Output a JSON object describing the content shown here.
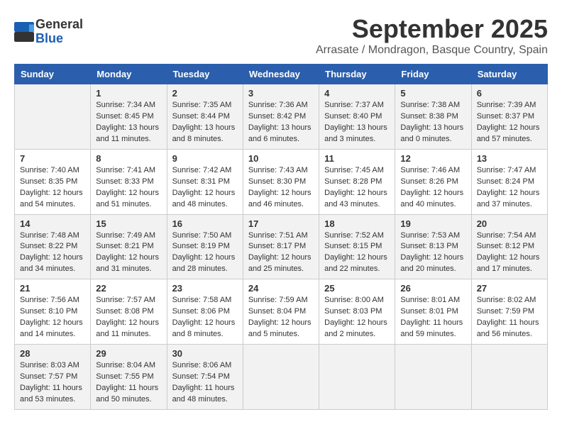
{
  "header": {
    "logo_line1": "General",
    "logo_line2": "Blue",
    "month": "September 2025",
    "location": "Arrasate / Mondragon, Basque Country, Spain"
  },
  "weekdays": [
    "Sunday",
    "Monday",
    "Tuesday",
    "Wednesday",
    "Thursday",
    "Friday",
    "Saturday"
  ],
  "weeks": [
    [
      {
        "day": "",
        "info": ""
      },
      {
        "day": "1",
        "info": "Sunrise: 7:34 AM\nSunset: 8:45 PM\nDaylight: 13 hours\nand 11 minutes."
      },
      {
        "day": "2",
        "info": "Sunrise: 7:35 AM\nSunset: 8:44 PM\nDaylight: 13 hours\nand 8 minutes."
      },
      {
        "day": "3",
        "info": "Sunrise: 7:36 AM\nSunset: 8:42 PM\nDaylight: 13 hours\nand 6 minutes."
      },
      {
        "day": "4",
        "info": "Sunrise: 7:37 AM\nSunset: 8:40 PM\nDaylight: 13 hours\nand 3 minutes."
      },
      {
        "day": "5",
        "info": "Sunrise: 7:38 AM\nSunset: 8:38 PM\nDaylight: 13 hours\nand 0 minutes."
      },
      {
        "day": "6",
        "info": "Sunrise: 7:39 AM\nSunset: 8:37 PM\nDaylight: 12 hours\nand 57 minutes."
      }
    ],
    [
      {
        "day": "7",
        "info": "Sunrise: 7:40 AM\nSunset: 8:35 PM\nDaylight: 12 hours\nand 54 minutes."
      },
      {
        "day": "8",
        "info": "Sunrise: 7:41 AM\nSunset: 8:33 PM\nDaylight: 12 hours\nand 51 minutes."
      },
      {
        "day": "9",
        "info": "Sunrise: 7:42 AM\nSunset: 8:31 PM\nDaylight: 12 hours\nand 48 minutes."
      },
      {
        "day": "10",
        "info": "Sunrise: 7:43 AM\nSunset: 8:30 PM\nDaylight: 12 hours\nand 46 minutes."
      },
      {
        "day": "11",
        "info": "Sunrise: 7:45 AM\nSunset: 8:28 PM\nDaylight: 12 hours\nand 43 minutes."
      },
      {
        "day": "12",
        "info": "Sunrise: 7:46 AM\nSunset: 8:26 PM\nDaylight: 12 hours\nand 40 minutes."
      },
      {
        "day": "13",
        "info": "Sunrise: 7:47 AM\nSunset: 8:24 PM\nDaylight: 12 hours\nand 37 minutes."
      }
    ],
    [
      {
        "day": "14",
        "info": "Sunrise: 7:48 AM\nSunset: 8:22 PM\nDaylight: 12 hours\nand 34 minutes."
      },
      {
        "day": "15",
        "info": "Sunrise: 7:49 AM\nSunset: 8:21 PM\nDaylight: 12 hours\nand 31 minutes."
      },
      {
        "day": "16",
        "info": "Sunrise: 7:50 AM\nSunset: 8:19 PM\nDaylight: 12 hours\nand 28 minutes."
      },
      {
        "day": "17",
        "info": "Sunrise: 7:51 AM\nSunset: 8:17 PM\nDaylight: 12 hours\nand 25 minutes."
      },
      {
        "day": "18",
        "info": "Sunrise: 7:52 AM\nSunset: 8:15 PM\nDaylight: 12 hours\nand 22 minutes."
      },
      {
        "day": "19",
        "info": "Sunrise: 7:53 AM\nSunset: 8:13 PM\nDaylight: 12 hours\nand 20 minutes."
      },
      {
        "day": "20",
        "info": "Sunrise: 7:54 AM\nSunset: 8:12 PM\nDaylight: 12 hours\nand 17 minutes."
      }
    ],
    [
      {
        "day": "21",
        "info": "Sunrise: 7:56 AM\nSunset: 8:10 PM\nDaylight: 12 hours\nand 14 minutes."
      },
      {
        "day": "22",
        "info": "Sunrise: 7:57 AM\nSunset: 8:08 PM\nDaylight: 12 hours\nand 11 minutes."
      },
      {
        "day": "23",
        "info": "Sunrise: 7:58 AM\nSunset: 8:06 PM\nDaylight: 12 hours\nand 8 minutes."
      },
      {
        "day": "24",
        "info": "Sunrise: 7:59 AM\nSunset: 8:04 PM\nDaylight: 12 hours\nand 5 minutes."
      },
      {
        "day": "25",
        "info": "Sunrise: 8:00 AM\nSunset: 8:03 PM\nDaylight: 12 hours\nand 2 minutes."
      },
      {
        "day": "26",
        "info": "Sunrise: 8:01 AM\nSunset: 8:01 PM\nDaylight: 11 hours\nand 59 minutes."
      },
      {
        "day": "27",
        "info": "Sunrise: 8:02 AM\nSunset: 7:59 PM\nDaylight: 11 hours\nand 56 minutes."
      }
    ],
    [
      {
        "day": "28",
        "info": "Sunrise: 8:03 AM\nSunset: 7:57 PM\nDaylight: 11 hours\nand 53 minutes."
      },
      {
        "day": "29",
        "info": "Sunrise: 8:04 AM\nSunset: 7:55 PM\nDaylight: 11 hours\nand 50 minutes."
      },
      {
        "day": "30",
        "info": "Sunrise: 8:06 AM\nSunset: 7:54 PM\nDaylight: 11 hours\nand 48 minutes."
      },
      {
        "day": "",
        "info": ""
      },
      {
        "day": "",
        "info": ""
      },
      {
        "day": "",
        "info": ""
      },
      {
        "day": "",
        "info": ""
      }
    ]
  ]
}
